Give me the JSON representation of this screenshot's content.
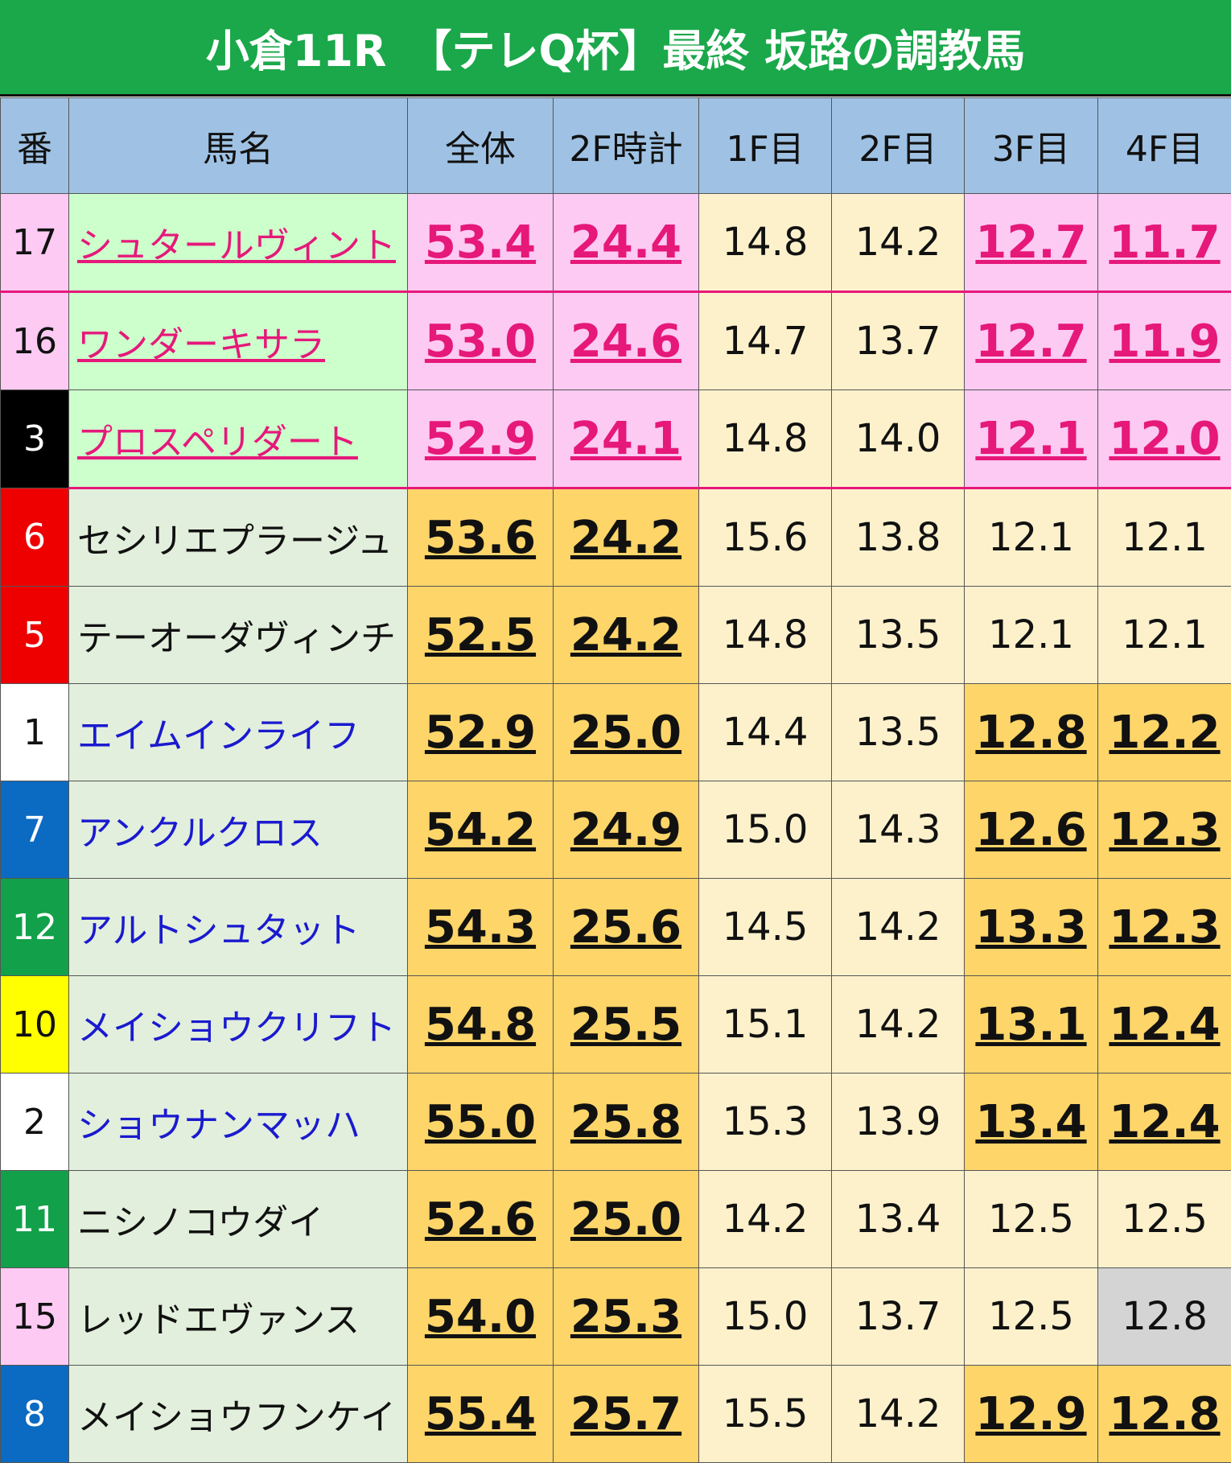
{
  "title": "小倉11R　【テレQ杯】最終 坂路の調教馬",
  "headers": {
    "num": "番",
    "name": "馬名",
    "total": "全体",
    "twoF": "2F時計",
    "f1": "1F目",
    "f2": "2F目",
    "f3": "3F目",
    "f4": "4F目"
  },
  "colors": {
    "title_bg": "#1aa84a",
    "header_bg": "#9fc2e4",
    "highlight_pink": "#fccaf2",
    "name_red": "#e6187a",
    "name_blue": "#1a1acf",
    "fast_orange": "#fdd569",
    "cream": "#fdf1cc"
  },
  "rows": [
    {
      "num": "17",
      "name": "シュタールヴィント",
      "total": "53.4",
      "twoF": "24.4",
      "f1": "14.8",
      "f2": "14.2",
      "f3": "12.7",
      "f4": "11.7"
    },
    {
      "num": "16",
      "name": "ワンダーキサラ",
      "total": "53.0",
      "twoF": "24.6",
      "f1": "14.7",
      "f2": "13.7",
      "f3": "12.7",
      "f4": "11.9"
    },
    {
      "num": "3",
      "name": "プロスペリダート",
      "total": "52.9",
      "twoF": "24.1",
      "f1": "14.8",
      "f2": "14.0",
      "f3": "12.1",
      "f4": "12.0"
    },
    {
      "num": "6",
      "name": "セシリエプラージュ",
      "total": "53.6",
      "twoF": "24.2",
      "f1": "15.6",
      "f2": "13.8",
      "f3": "12.1",
      "f4": "12.1"
    },
    {
      "num": "5",
      "name": "テーオーダヴィンチ",
      "total": "52.5",
      "twoF": "24.2",
      "f1": "14.8",
      "f2": "13.5",
      "f3": "12.1",
      "f4": "12.1"
    },
    {
      "num": "1",
      "name": "エイムインライフ",
      "total": "52.9",
      "twoF": "25.0",
      "f1": "14.4",
      "f2": "13.5",
      "f3": "12.8",
      "f4": "12.2"
    },
    {
      "num": "7",
      "name": "アンクルクロス",
      "total": "54.2",
      "twoF": "24.9",
      "f1": "15.0",
      "f2": "14.3",
      "f3": "12.6",
      "f4": "12.3"
    },
    {
      "num": "12",
      "name": "アルトシュタット",
      "total": "54.3",
      "twoF": "25.6",
      "f1": "14.5",
      "f2": "14.2",
      "f3": "13.3",
      "f4": "12.3"
    },
    {
      "num": "10",
      "name": "メイショウクリフト",
      "total": "54.8",
      "twoF": "25.5",
      "f1": "15.1",
      "f2": "14.2",
      "f3": "13.1",
      "f4": "12.4"
    },
    {
      "num": "2",
      "name": "ショウナンマッハ",
      "total": "55.0",
      "twoF": "25.8",
      "f1": "15.3",
      "f2": "13.9",
      "f3": "13.4",
      "f4": "12.4"
    },
    {
      "num": "11",
      "name": "ニシノコウダイ",
      "total": "52.6",
      "twoF": "25.0",
      "f1": "14.2",
      "f2": "13.4",
      "f3": "12.5",
      "f4": "12.5"
    },
    {
      "num": "15",
      "name": "レッドエヴァンス",
      "total": "54.0",
      "twoF": "25.3",
      "f1": "15.0",
      "f2": "13.7",
      "f3": "12.5",
      "f4": "12.8"
    },
    {
      "num": "8",
      "name": "メイショウフンケイ",
      "total": "55.4",
      "twoF": "25.7",
      "f1": "15.5",
      "f2": "14.2",
      "f3": "12.9",
      "f4": "12.8"
    }
  ]
}
